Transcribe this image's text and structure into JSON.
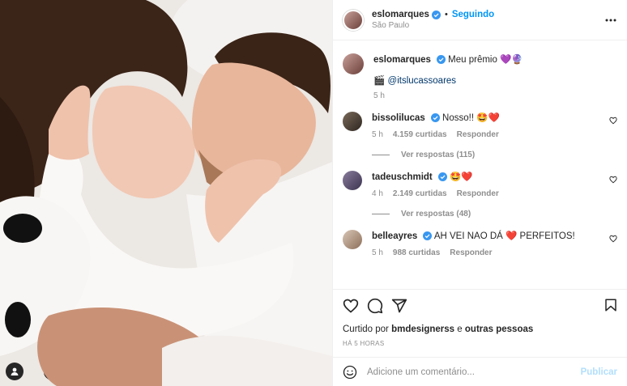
{
  "author": {
    "username": "eslomarques",
    "follow_status": "Seguindo",
    "separator": "•",
    "location": "São Paulo"
  },
  "caption": {
    "username": "eslomarques",
    "text": "Meu prêmio 💜🔮",
    "tag_line": "🎬 @itslucassoares",
    "time": "5 h"
  },
  "comments": [
    {
      "username": "bissolilucas",
      "text": "Nosso!! 🤩❤️",
      "time": "5 h",
      "likes": "4.159 curtidas",
      "reply": "Responder",
      "replies": "Ver respostas (115)"
    },
    {
      "username": "tadeuschmidt",
      "text": "🤩❤️",
      "time": "4 h",
      "likes": "2.149 curtidas",
      "reply": "Responder",
      "replies": "Ver respostas (48)"
    },
    {
      "username": "belleayres",
      "text": "AH VEI NAO DÁ ❤️ PERFEITOS!",
      "time": "5 h",
      "likes": "988 curtidas",
      "reply": "Responder"
    }
  ],
  "likes": {
    "prefix": "Curtido por",
    "user": "bmdesignerss",
    "joiner": "e",
    "others": "outras pessoas"
  },
  "timestamp": "HÁ 5 HORAS",
  "add_comment": {
    "placeholder": "Adicione um comentário...",
    "publish": "Publicar"
  },
  "icons": {
    "verified": "verified-badge-icon",
    "more": "more-options-icon",
    "like": "heart-icon",
    "comment": "comment-icon",
    "share": "share-icon",
    "save": "bookmark-icon",
    "emoji": "emoji-icon",
    "user_tag": "user-tag-icon"
  },
  "colors": {
    "accent": "#0095f6",
    "verified": "#3897f0",
    "publish_disabled": "#b2dffc",
    "muted": "#8e8e8e",
    "link": "#00376b"
  }
}
